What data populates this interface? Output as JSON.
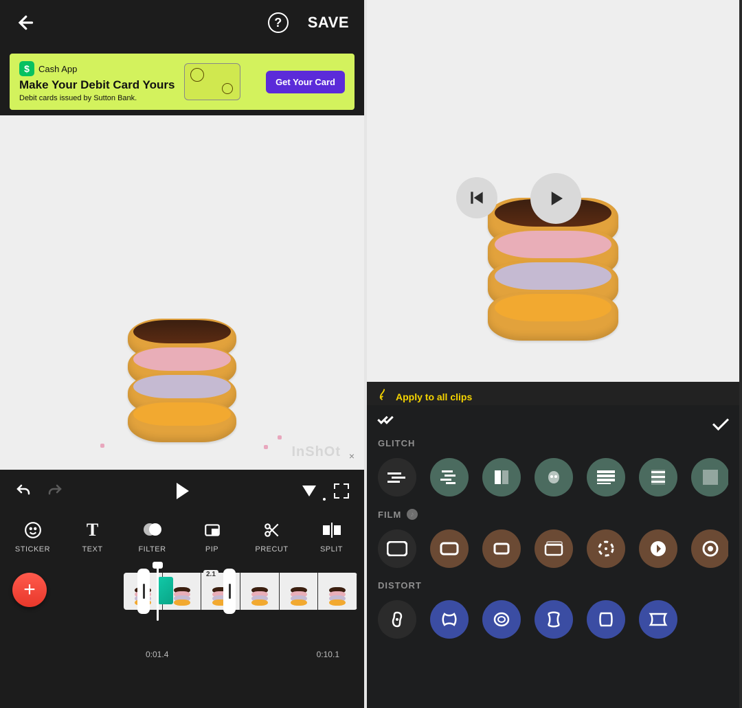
{
  "header": {
    "save_label": "SAVE",
    "help_glyph": "?"
  },
  "ad": {
    "brand": "Cash App",
    "headline": "Make Your Debit Card Yours",
    "sub": "Debit cards issued by Sutton Bank.",
    "cta": "Get Your Card",
    "logo_glyph": "$"
  },
  "watermark": "InShOt",
  "tools": [
    {
      "id": "sticker",
      "label": "STICKER"
    },
    {
      "id": "text",
      "label": "TEXT"
    },
    {
      "id": "filter",
      "label": "FILTER"
    },
    {
      "id": "pip",
      "label": "PIP"
    },
    {
      "id": "precut",
      "label": "PRECUT"
    },
    {
      "id": "split",
      "label": "SPLIT"
    }
  ],
  "timeline": {
    "add_glyph": "+",
    "speed_tag": "2.1",
    "time_a": "0:01.4",
    "time_b": "0:10.1"
  },
  "right": {
    "tooltip": "Apply to all clips",
    "categories": {
      "glitch": {
        "label": "GLITCH",
        "count": 7
      },
      "film": {
        "label": "FILM",
        "count": 7,
        "music_badge": true
      },
      "distort": {
        "label": "DISTORT",
        "count": 6
      }
    }
  }
}
